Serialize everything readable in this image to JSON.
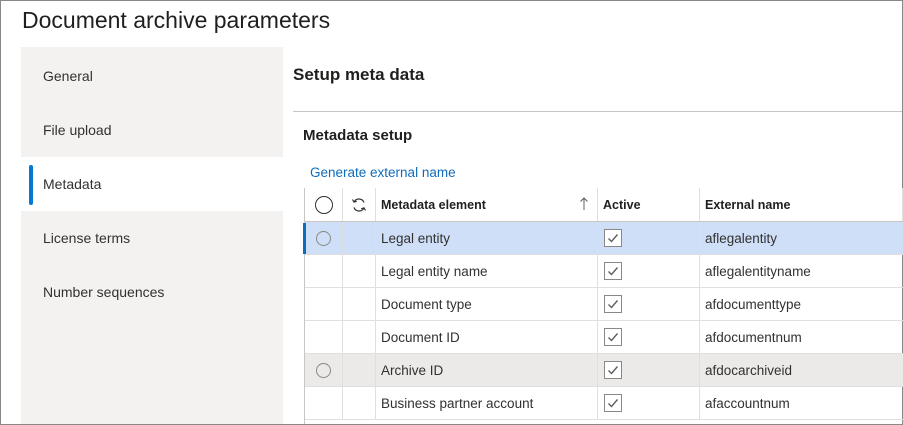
{
  "window": {
    "title": "Document archive parameters"
  },
  "nav": {
    "items": [
      {
        "label": "General",
        "selected": false
      },
      {
        "label": "File upload",
        "selected": false
      },
      {
        "label": "Metadata",
        "selected": true
      },
      {
        "label": "License terms",
        "selected": false
      },
      {
        "label": "Number sequences",
        "selected": false
      }
    ]
  },
  "main": {
    "section_title": "Setup meta data",
    "group_title": "Metadata setup",
    "action_link": "Generate external name",
    "grid": {
      "headers": {
        "element": "Metadata element",
        "active": "Active",
        "external": "External name"
      },
      "rows": [
        {
          "element": "Legal entity",
          "active": true,
          "external": "aflegalentity"
        },
        {
          "element": "Legal entity name",
          "active": true,
          "external": "aflegalentityname"
        },
        {
          "element": "Document type",
          "active": true,
          "external": "afdocumenttype"
        },
        {
          "element": "Document ID",
          "active": true,
          "external": "afdocumentnum"
        },
        {
          "element": "Archive ID",
          "active": true,
          "external": "afdocarchiveid"
        },
        {
          "element": "Business partner account",
          "active": true,
          "external": "afaccountnum"
        }
      ]
    }
  },
  "colors": {
    "accent": "#0078d4",
    "link": "#0f6cbd",
    "selected_row": "#cfdff8",
    "nav_bg": "#f3f2f1"
  }
}
